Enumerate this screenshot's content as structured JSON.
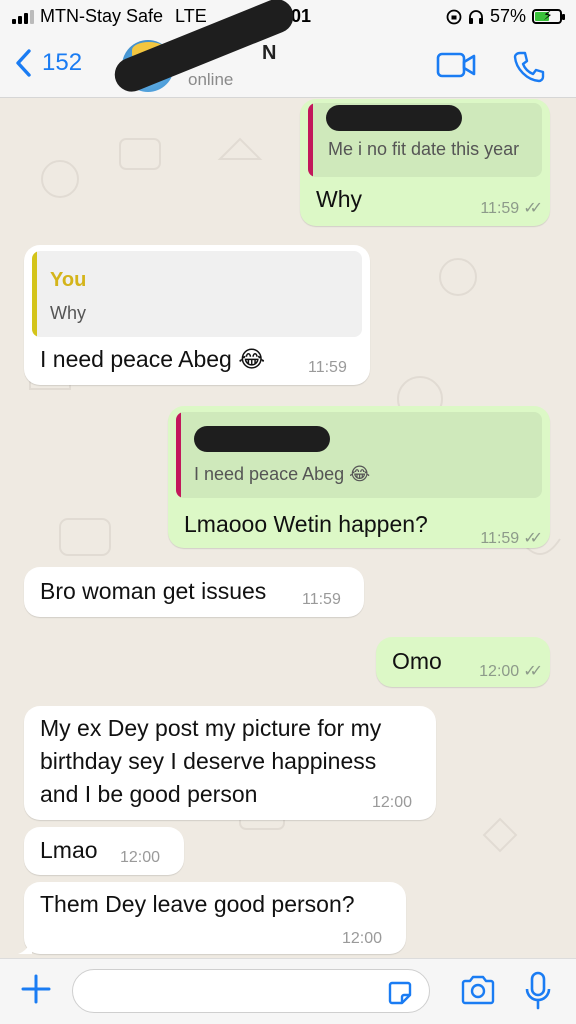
{
  "status_bar": {
    "carrier": "MTN-Stay Safe",
    "network": "LTE",
    "time": "12:01",
    "battery_percent": "57%",
    "battery_level": 0.57,
    "signal_bars": 3
  },
  "header": {
    "back_count": "152",
    "contact_name": "N",
    "contact_status": "online",
    "accent_color": "#1a7cf3"
  },
  "messages": [
    {
      "dir": "out",
      "quote_text": "Me i no fit date this year",
      "text": "Why",
      "time": "11:59"
    },
    {
      "dir": "in",
      "quote_name": "You",
      "quote_text": "Why",
      "text": "I need peace Abeg 😂",
      "time": "11:59"
    },
    {
      "dir": "out",
      "quote_text": "I need peace Abeg 😂",
      "text": "Lmaooo Wetin happen?",
      "time": "11:59"
    },
    {
      "dir": "in",
      "text": "Bro woman get issues",
      "time": "11:59"
    },
    {
      "dir": "out",
      "text": "Omo",
      "time": "12:00"
    },
    {
      "dir": "in",
      "lines": [
        "My ex Dey post my picture for my",
        "birthday sey I deserve happiness",
        "and I be good person"
      ],
      "time": "12:00"
    },
    {
      "dir": "in",
      "text": "Lmao",
      "time": "12:00"
    },
    {
      "dir": "in",
      "text": "Them Dey leave good person?",
      "time": "12:00"
    }
  ],
  "ticks": "✓✓",
  "composer": {
    "placeholder": ""
  },
  "colors": {
    "incoming_bubble": "#ffffff",
    "outgoing_bubble": "#dcf8c6",
    "chat_background": "#efeae2",
    "quote_bar_you": "#d4c41a",
    "quote_bar_contact": "#c2185b"
  }
}
